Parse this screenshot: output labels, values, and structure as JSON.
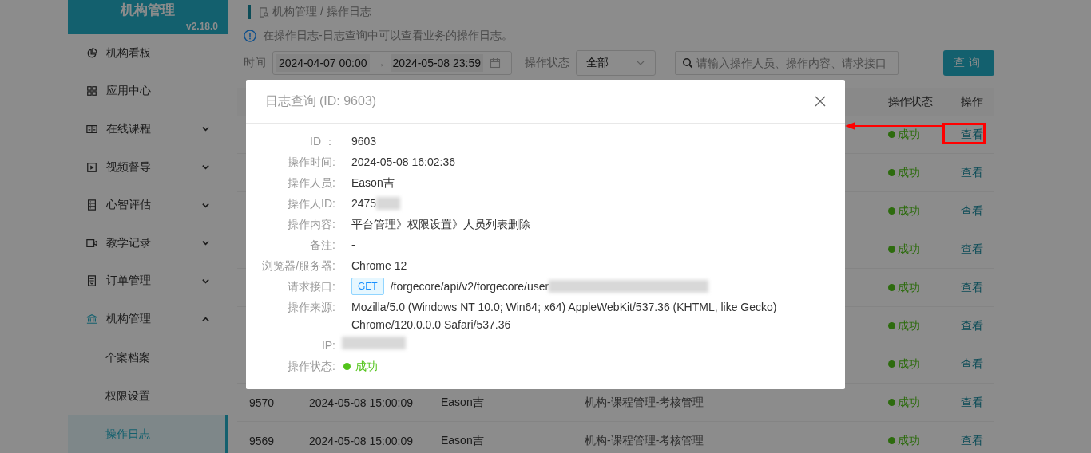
{
  "sidebar": {
    "title": "机构管理",
    "version": "v2.18.0",
    "items": [
      {
        "label": "机构看板",
        "kind": "link"
      },
      {
        "label": "应用中心",
        "kind": "link"
      },
      {
        "label": "在线课程",
        "kind": "group",
        "expanded": false
      },
      {
        "label": "视频督导",
        "kind": "group",
        "expanded": false
      },
      {
        "label": "心智评估",
        "kind": "group",
        "expanded": false
      },
      {
        "label": "教学记录",
        "kind": "group",
        "expanded": false
      },
      {
        "label": "订单管理",
        "kind": "group",
        "expanded": false
      },
      {
        "label": "机构管理",
        "kind": "group",
        "expanded": true,
        "children": [
          {
            "label": "个案档案",
            "selected": false
          },
          {
            "label": "权限设置",
            "selected": false
          },
          {
            "label": "操作日志",
            "selected": true
          }
        ]
      }
    ]
  },
  "breadcrumb": "机构管理 / 操作日志",
  "notice": "在操作日志-日志查询中可以查看业务的操作日志。",
  "filters": {
    "time_label": "时间",
    "start": "2024-04-07 00:00",
    "separator": "→",
    "end": "2024-05-08 23:59",
    "status_label": "操作状态",
    "status_value": "全部",
    "search": {
      "placeholder": "请输入操作人员、操作内容、请求接口"
    },
    "button": "查询"
  },
  "table": {
    "columns": {
      "status": "操作状态",
      "action": "操作"
    },
    "rows": [
      {
        "status_text": "成功",
        "action": "查看"
      },
      {
        "status_text": "成功",
        "action": "查看"
      },
      {
        "status_text": "成功",
        "action": "查看"
      },
      {
        "status_text": "成功",
        "action": "查看"
      },
      {
        "status_text": "成功",
        "action": "查看"
      },
      {
        "status_text": "成功",
        "action": "查看"
      },
      {
        "status_text": "成功",
        "action": "查看"
      },
      {
        "id": "9570",
        "time": "2024-05-08 15:00:09",
        "operator": "Eason吉",
        "content": "机构-课程管理-考核管理",
        "status_text": "成功",
        "action": "查看"
      },
      {
        "id": "9569",
        "time": "2024-05-08 15:00:09",
        "operator": "Eason吉",
        "content": "机构-课程管理-考核管理",
        "status_text": "成功",
        "action": "查看"
      }
    ]
  },
  "modal": {
    "title": "日志查询",
    "subtitle": "(ID: 9603)",
    "fields": [
      {
        "label": "ID ：",
        "kind": "text",
        "value": "9603"
      },
      {
        "label": "操作时间:",
        "kind": "text",
        "value": "2024-05-08 16:02:36"
      },
      {
        "label": "操作人员:",
        "kind": "text",
        "value": "Eason吉"
      },
      {
        "label": "操作人ID:",
        "kind": "redacted",
        "value": "2475"
      },
      {
        "label": "操作内容:",
        "kind": "text",
        "value": "平台管理》权限设置》人员列表删除"
      },
      {
        "label": "备注:",
        "kind": "text",
        "value": "-"
      },
      {
        "label": "浏览器/服务器:",
        "kind": "text",
        "value": "Chrome 12"
      },
      {
        "label": "请求接口:",
        "kind": "request",
        "method": "GET",
        "value": "/forgecore/api/v2/forgecore/user"
      },
      {
        "label": "操作来源:",
        "kind": "text",
        "value": "Mozilla/5.0 (Windows NT 10.0; Win64; x64) AppleWebKit/537.36 (KHTML, like Gecko) Chrome/120.0.0.0 Safari/537.36"
      },
      {
        "label": "IP:",
        "kind": "redacted"
      },
      {
        "label": "操作状态:",
        "kind": "status",
        "value": "成功"
      }
    ]
  }
}
